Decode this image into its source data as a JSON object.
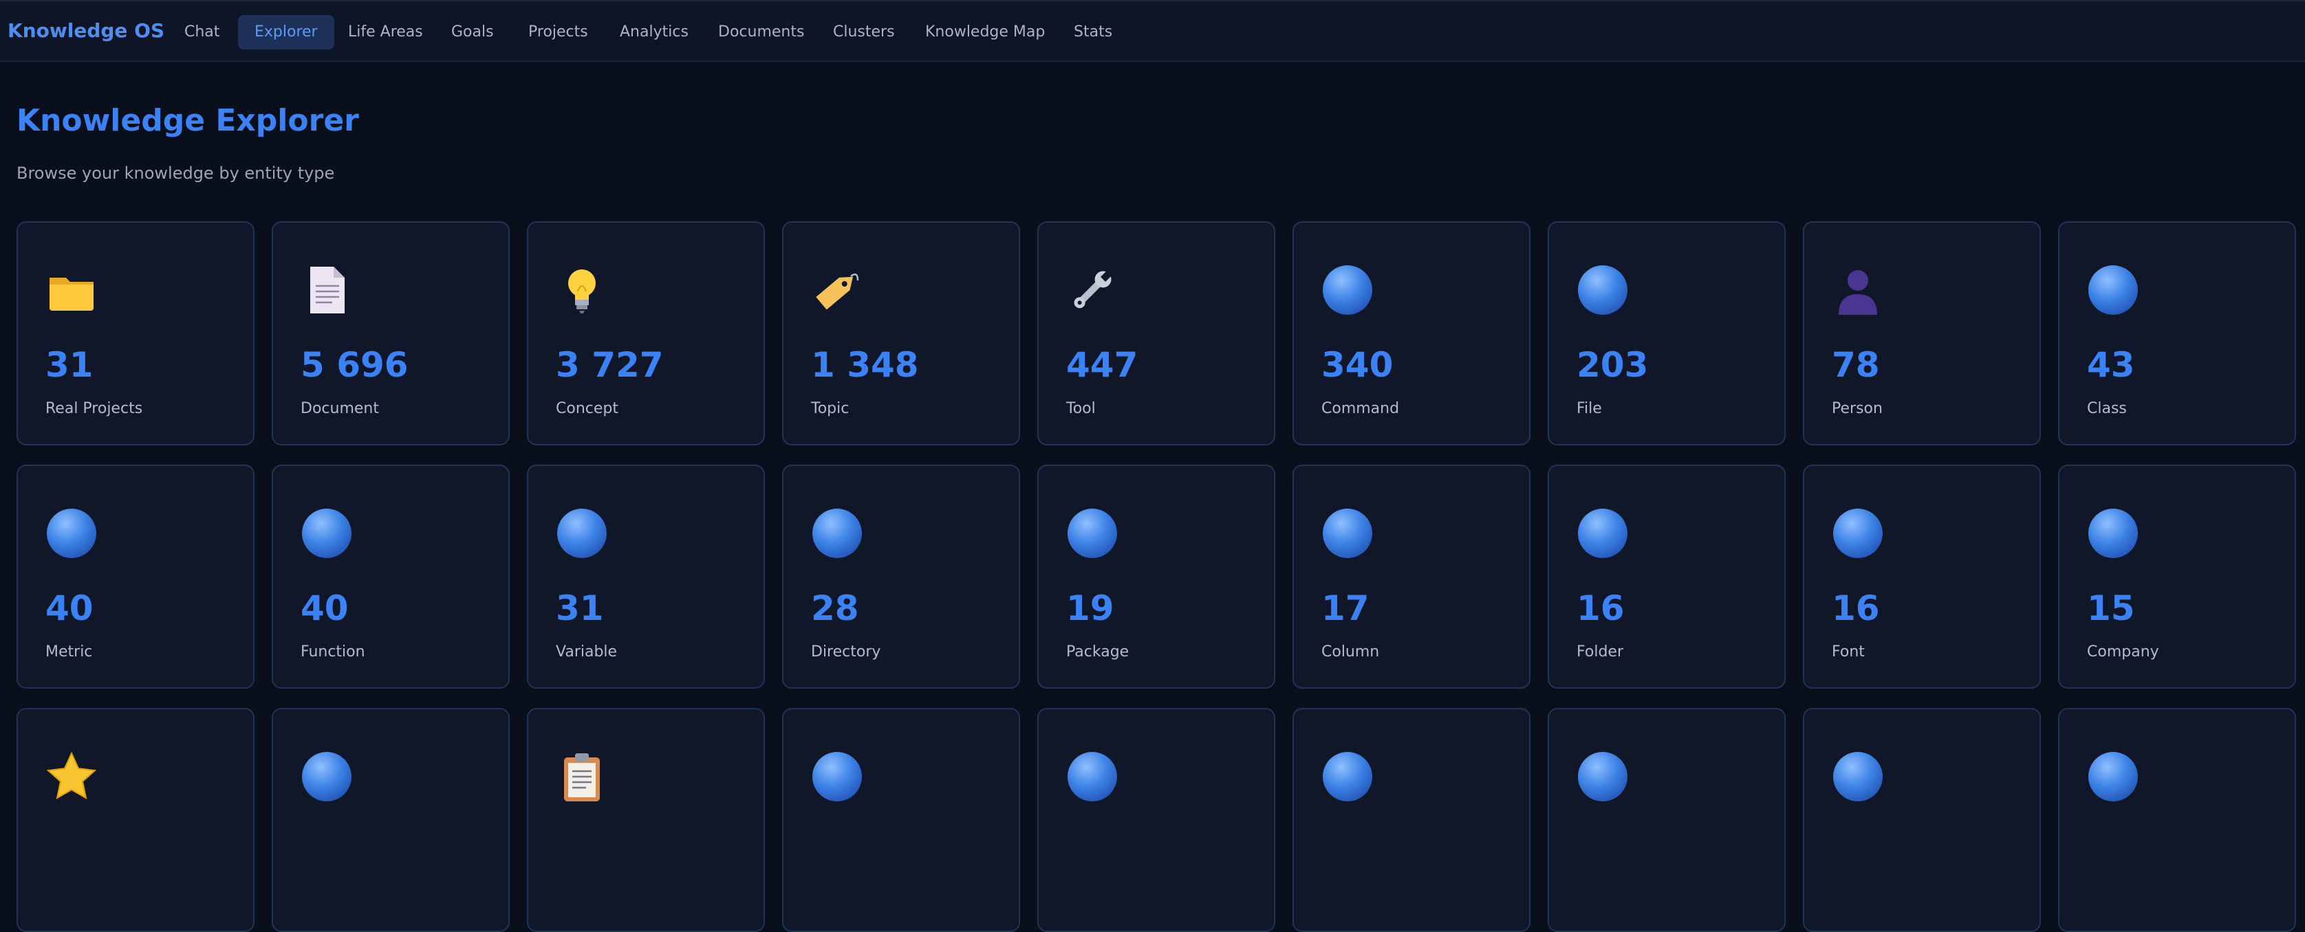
{
  "app": {
    "brand": "Knowledge OS"
  },
  "nav": {
    "tabs": [
      {
        "label": "Chat",
        "active": false
      },
      {
        "label": "Explorer",
        "active": true
      },
      {
        "label": "Life Areas",
        "active": false
      },
      {
        "label": "Goals",
        "active": false
      },
      {
        "label": "Projects",
        "active": false
      },
      {
        "label": "Analytics",
        "active": false
      },
      {
        "label": "Documents",
        "active": false
      },
      {
        "label": "Clusters",
        "active": false
      },
      {
        "label": "Knowledge Map",
        "active": false
      },
      {
        "label": "Stats",
        "active": false
      }
    ]
  },
  "page": {
    "title": "Knowledge Explorer",
    "subtitle": "Browse your knowledge by entity type"
  },
  "colors": {
    "accent": "#3b82f6",
    "card_border": "#1e3558",
    "background": "#0a0f1c"
  },
  "entities": [
    {
      "count": "31",
      "label": "Real Projects",
      "icon": "folder-icon"
    },
    {
      "count": "5 696",
      "label": "Document",
      "icon": "document-icon"
    },
    {
      "count": "3 727",
      "label": "Concept",
      "icon": "lightbulb-icon"
    },
    {
      "count": "1 348",
      "label": "Topic",
      "icon": "tag-icon"
    },
    {
      "count": "447",
      "label": "Tool",
      "icon": "wrench-icon"
    },
    {
      "count": "340",
      "label": "Command",
      "icon": "blue-circle-icon"
    },
    {
      "count": "203",
      "label": "File",
      "icon": "blue-circle-icon"
    },
    {
      "count": "78",
      "label": "Person",
      "icon": "person-silhouette-icon"
    },
    {
      "count": "43",
      "label": "Class",
      "icon": "blue-circle-icon"
    },
    {
      "count": "40",
      "label": "Metric",
      "icon": "blue-circle-icon"
    },
    {
      "count": "40",
      "label": "Function",
      "icon": "blue-circle-icon"
    },
    {
      "count": "31",
      "label": "Variable",
      "icon": "blue-circle-icon"
    },
    {
      "count": "28",
      "label": "Directory",
      "icon": "blue-circle-icon"
    },
    {
      "count": "19",
      "label": "Package",
      "icon": "blue-circle-icon"
    },
    {
      "count": "17",
      "label": "Column",
      "icon": "blue-circle-icon"
    },
    {
      "count": "16",
      "label": "Folder",
      "icon": "blue-circle-icon"
    },
    {
      "count": "16",
      "label": "Font",
      "icon": "blue-circle-icon"
    },
    {
      "count": "15",
      "label": "Company",
      "icon": "blue-circle-icon"
    },
    {
      "count": "",
      "label": "",
      "icon": "star-icon"
    },
    {
      "count": "",
      "label": "",
      "icon": "blue-circle-icon"
    },
    {
      "count": "",
      "label": "",
      "icon": "clipboard-icon"
    },
    {
      "count": "",
      "label": "",
      "icon": "blue-circle-icon"
    },
    {
      "count": "",
      "label": "",
      "icon": "blue-circle-icon"
    },
    {
      "count": "",
      "label": "",
      "icon": "blue-circle-icon"
    },
    {
      "count": "",
      "label": "",
      "icon": "blue-circle-icon"
    },
    {
      "count": "",
      "label": "",
      "icon": "blue-circle-icon"
    },
    {
      "count": "",
      "label": "",
      "icon": "blue-circle-icon"
    }
  ]
}
